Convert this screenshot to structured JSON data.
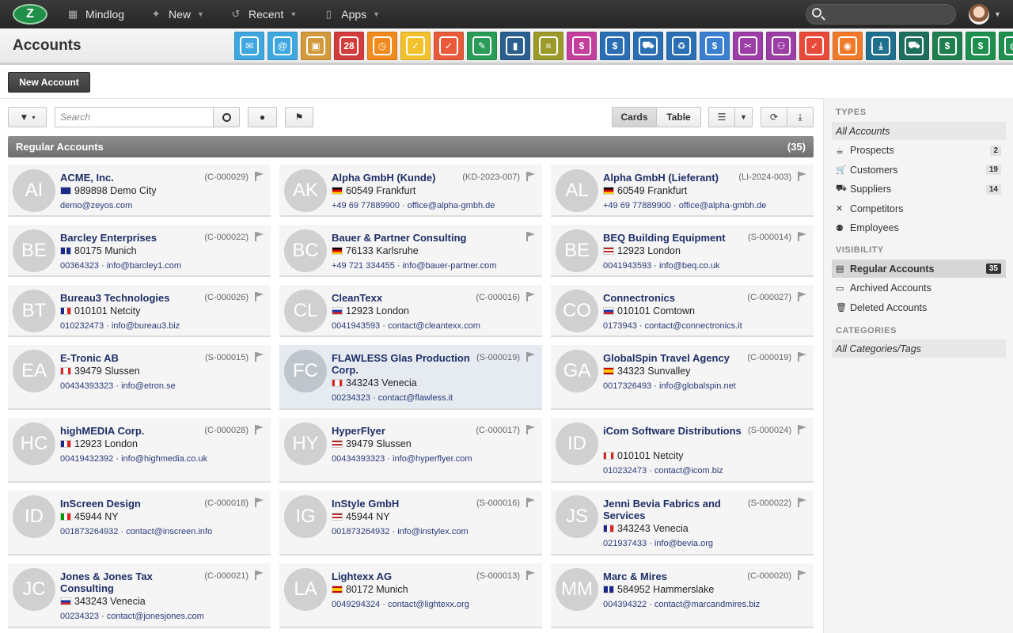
{
  "topbar": {
    "logo_icon": "zeyos-logo-icon",
    "items": [
      {
        "label": "Mindlog",
        "icon": "chat-icon"
      },
      {
        "label": "New",
        "icon": "sparkle-icon",
        "caret": true
      },
      {
        "label": "Recent",
        "icon": "history-icon",
        "caret": true
      },
      {
        "label": "Apps",
        "icon": "tablet-icon",
        "caret": true
      }
    ]
  },
  "header": {
    "title": "Accounts",
    "app_icons": [
      {
        "name": "messages-app-icon",
        "color": "#3ea7df",
        "glyph": "✉"
      },
      {
        "name": "email-app-icon",
        "color": "#3ea7df",
        "glyph": "@"
      },
      {
        "name": "contacts-app-icon",
        "color": "#d29a3b",
        "glyph": "▣"
      },
      {
        "name": "calendar-app-icon",
        "color": "#d23c3c",
        "glyph": "28"
      },
      {
        "name": "timer-app-icon",
        "color": "#f08a1c",
        "glyph": "◷"
      },
      {
        "name": "tasks-app-icon",
        "color": "#f2c12c",
        "glyph": "✓"
      },
      {
        "name": "projects-app-icon",
        "color": "#e85a3a",
        "glyph": "✓"
      },
      {
        "name": "notes-app-icon",
        "color": "#2a9c58",
        "glyph": "✎"
      },
      {
        "name": "bookmarks-app-icon",
        "color": "#2a5f8f",
        "glyph": "▮"
      },
      {
        "name": "documents-app-icon",
        "color": "#9c9a2a",
        "glyph": "≡"
      },
      {
        "name": "sales-app-icon",
        "color": "#c43e9e",
        "glyph": "$"
      },
      {
        "name": "finance-app-icon",
        "color": "#2a6fb4",
        "glyph": "$"
      },
      {
        "name": "shipping-app-icon",
        "color": "#2a6fb4",
        "glyph": "⛟"
      },
      {
        "name": "support-app-icon",
        "color": "#2a6fb4",
        "glyph": "♻"
      },
      {
        "name": "payments-app-icon",
        "color": "#3a7fd0",
        "glyph": "$"
      },
      {
        "name": "campaigns-app-icon",
        "color": "#9c3ea6",
        "glyph": "✂"
      },
      {
        "name": "deals-app-icon",
        "color": "#9c3ea6",
        "glyph": "⚇"
      },
      {
        "name": "contracts-app-icon",
        "color": "#e84a3a",
        "glyph": "✓"
      },
      {
        "name": "broadcast-app-icon",
        "color": "#f07a2a",
        "glyph": "◉"
      },
      {
        "name": "downloads-app-icon",
        "color": "#1f6f8f",
        "glyph": "⤓"
      },
      {
        "name": "shop-app-icon",
        "color": "#1f6f5f",
        "glyph": "⛟"
      },
      {
        "name": "billing-app-icon",
        "color": "#1f7f4f",
        "glyph": "$"
      },
      {
        "name": "pricing-app-icon",
        "color": "#1f8f4f",
        "glyph": "$"
      },
      {
        "name": "database-app-icon",
        "color": "#1f8f4f",
        "glyph": "◍"
      }
    ]
  },
  "toolbar": {
    "new_account_label": "New Account",
    "search_placeholder": "Search",
    "cards_label": "Cards",
    "table_label": "Table"
  },
  "section": {
    "title": "Regular Accounts",
    "count": "(35)"
  },
  "cards": [
    {
      "initials": "AI",
      "name": "ACME, Inc.",
      "code": "(C-000029)",
      "flag": "au",
      "city": "989898 Demo City",
      "contact": "demo@zeyos.com"
    },
    {
      "initials": "AK",
      "name": "Alpha GmbH (Kunde)",
      "code": "(KD-2023-007)",
      "flag": "de",
      "city": "60549 Frankfurt",
      "contact": "+49 69 77889900 · office@alpha-gmbh.de"
    },
    {
      "initials": "AL",
      "name": "Alpha GmbH (Lieferant)",
      "code": "(LI-2024-003)",
      "flag": "de",
      "city": "60549 Frankfurt",
      "contact": "+49 69 77889900 · office@alpha-gmbh.de"
    },
    {
      "initials": "BE",
      "name": "Barcley Enterprises",
      "code": "(C-000022)",
      "flag": "gb",
      "city": "80175 Munich",
      "contact": "00364323 · info@barcley1.com"
    },
    {
      "initials": "BC",
      "name": "Bauer & Partner Consulting",
      "code": "",
      "flag": "de",
      "city": "76133 Karlsruhe",
      "contact": "+49 721 334455 · info@bauer-partner.com"
    },
    {
      "initials": "BE",
      "name": "BEQ Building Equipment",
      "code": "(S-000014)",
      "flag": "us",
      "city": "12923 London",
      "contact": "0041943593 · info@beq.co.uk"
    },
    {
      "initials": "BT",
      "name": "Bureau3 Technologies",
      "code": "(C-000026)",
      "flag": "fr",
      "city": "010101 Netcity",
      "contact": "010232473 · info@bureau3.biz"
    },
    {
      "initials": "CL",
      "name": "CleanTexx",
      "code": "(C-000016)",
      "flag": "ru",
      "city": "12923 London",
      "contact": "0041943593 · contact@cleantexx.com"
    },
    {
      "initials": "CO",
      "name": "Connectronics",
      "code": "(C-000027)",
      "flag": "ru",
      "city": "010101 Comtown",
      "contact": "0173943 · contact@connectronics.it"
    },
    {
      "initials": "EA",
      "name": "E-Tronic AB",
      "code": "(S-000015)",
      "flag": "ca",
      "city": "39479 Slussen",
      "contact": "00434393323 · info@etron.se"
    },
    {
      "initials": "FC",
      "name": "FLAWLESS Glas Production Corp.",
      "code": "(S-000019)",
      "flag": "ca",
      "city": "343243 Venecia",
      "contact": "00234323 · contact@flawless.it",
      "selected": true
    },
    {
      "initials": "GA",
      "name": "GlobalSpin Travel Agency",
      "code": "(C-000019)",
      "flag": "es",
      "city": "34323 Sunvalley",
      "contact": "0017326493 · info@globalspin.net"
    },
    {
      "initials": "HC",
      "name": "highMEDIA Corp.",
      "code": "(C-000028)",
      "flag": "fr",
      "city": "12923 London",
      "contact": "00419432392 · info@highmedia.co.uk"
    },
    {
      "initials": "HY",
      "name": "HyperFlyer",
      "code": "(C-000017)",
      "flag": "us",
      "city": "39479 Slussen",
      "contact": "00434393323 · info@hyperflyer.com"
    },
    {
      "initials": "ID",
      "name": "iCom Software Distributions",
      "code": "(S-000024)",
      "flag": "ca",
      "city": "010101 Netcity",
      "contact": "010232473 · contact@icom.biz"
    },
    {
      "initials": "ID",
      "name": "InScreen Design",
      "code": "(C-000018)",
      "flag": "it",
      "city": "45944 NY",
      "contact": "001873264932 · contact@inscreen.info"
    },
    {
      "initials": "IG",
      "name": "InStyle GmbH",
      "code": "(S-000016)",
      "flag": "us",
      "city": "45944 NY",
      "contact": "001873264932 · info@instylex.com"
    },
    {
      "initials": "JS",
      "name": "Jenni Bevia Fabrics and Services",
      "code": "(S-000022)",
      "flag": "fr",
      "city": "343243 Venecia",
      "contact": "021937433 · info@bevia.org"
    },
    {
      "initials": "JC",
      "name": "Jones & Jones Tax Consulting",
      "code": "(C-000021)",
      "flag": "ru",
      "city": "343243 Venecia",
      "contact": "00234323 · contact@jonesjones.com"
    },
    {
      "initials": "LA",
      "name": "Lightexx AG",
      "code": "(S-000013)",
      "flag": "es",
      "city": "80172 Munich",
      "contact": "0049294324 · contact@lightexx.org"
    },
    {
      "initials": "MM",
      "name": "Marc & Mires",
      "code": "(C-000020)",
      "flag": "gb",
      "city": "584952 Hammerslake",
      "contact": "004394322 · contact@marcandmires.biz"
    }
  ],
  "sidebar": {
    "types_heading": "TYPES",
    "types": [
      {
        "label": "All Accounts",
        "italic": true
      },
      {
        "label": "Prospects",
        "icon": "cup-icon",
        "glyph": "☕",
        "badge": "2"
      },
      {
        "label": "Customers",
        "icon": "cart-icon",
        "glyph": "🛒",
        "badge": "19"
      },
      {
        "label": "Suppliers",
        "icon": "truck-icon",
        "glyph": "⛟",
        "badge": "14"
      },
      {
        "label": "Competitors",
        "icon": "swords-icon",
        "glyph": "✕"
      },
      {
        "label": "Employees",
        "icon": "people-icon",
        "glyph": "⚉"
      }
    ],
    "visibility_heading": "VISIBILITY",
    "visibility": [
      {
        "label": "Regular Accounts",
        "icon": "inbox-icon",
        "glyph": "▤",
        "badge": "35",
        "active": true
      },
      {
        "label": "Archived Accounts",
        "icon": "archive-icon",
        "glyph": "▭"
      },
      {
        "label": "Deleted Accounts",
        "icon": "trash-icon",
        "glyph": "🗑"
      }
    ],
    "categories_heading": "CATEGORIES",
    "categories": [
      {
        "label": "All Categories/Tags",
        "italic": true
      }
    ]
  }
}
